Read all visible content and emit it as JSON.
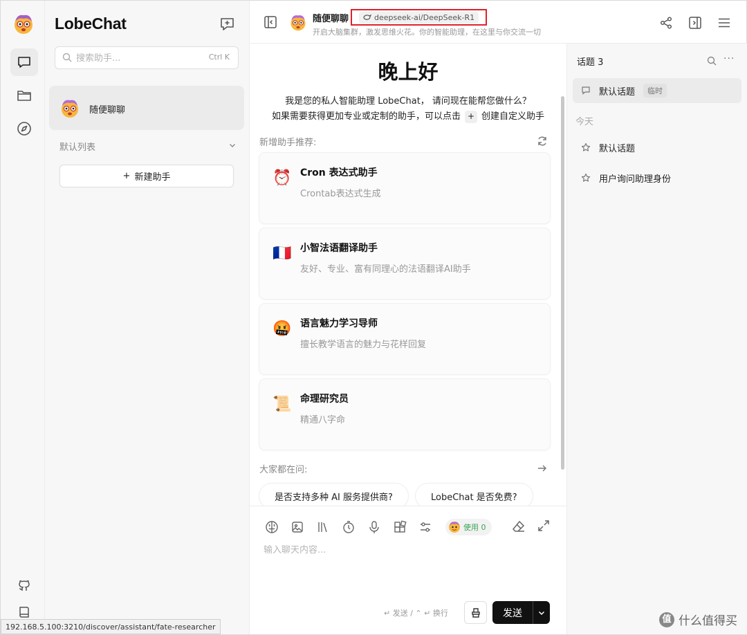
{
  "app": {
    "brand": "LobeChat",
    "status_url": "192.168.5.100:3210/discover/assistant/fate-researcher",
    "accent": "#111111",
    "highlight_border": "#e0202a"
  },
  "rail": {
    "icons": [
      "chat-icon",
      "folder-icon",
      "compass-icon",
      "github-icon",
      "book-icon"
    ]
  },
  "sessions": {
    "search_placeholder": "搜索助手...",
    "search_shortcut": "Ctrl K",
    "active_item": "随便聊聊",
    "group_title": "默认列表",
    "new_assistant": "新建助手"
  },
  "header": {
    "title": "随便聊聊",
    "model": "deepseek-ai/DeepSeek-R1",
    "subtitle": "开启大脑集群，激发思维火花。你的智能助理，在这里与你交流一切"
  },
  "welcome": {
    "greeting": "晚上好",
    "line1": "我是您的私人智能助理 LobeChat， 请问现在能帮您做什么？",
    "line2_before": "如果需要获得更加专业或定制的助手，可以点击",
    "line2_plus": "+",
    "line2_after": "创建自定义助手",
    "recommend_title": "新增助手推荐:",
    "cards": [
      {
        "title": "Cron 表达式助手",
        "desc": "Crontab表达式生成",
        "icon": "⏰"
      },
      {
        "title": "小智法语翻译助手",
        "desc": "友好、专业、富有同理心的法语翻译AI助手",
        "icon": "🇫🇷"
      },
      {
        "title": "语言魅力学习导师",
        "desc": "擅长教学语言的魅力与花样回复",
        "icon": "🤬"
      },
      {
        "title": "命理研究员",
        "desc": "精通八字命",
        "icon": "📜"
      }
    ],
    "ask_title": "大家都在问:",
    "questions": [
      "是否支持多种 AI 服务提供商?",
      "LobeChat 是否免费?"
    ]
  },
  "composer": {
    "usage": "使用 0",
    "placeholder": "输入聊天内容...",
    "hint": "↵ 发送 / ⌃ ↵ 换行",
    "send": "发送"
  },
  "topics": {
    "title": "话题 3",
    "day_label": "今天",
    "items": [
      {
        "label": "默认话题",
        "badge": "临时"
      },
      {
        "label": "默认话题"
      },
      {
        "label": "用户询问助理身份"
      }
    ]
  },
  "watermark": {
    "mark": "值",
    "text": "什么值得买"
  }
}
